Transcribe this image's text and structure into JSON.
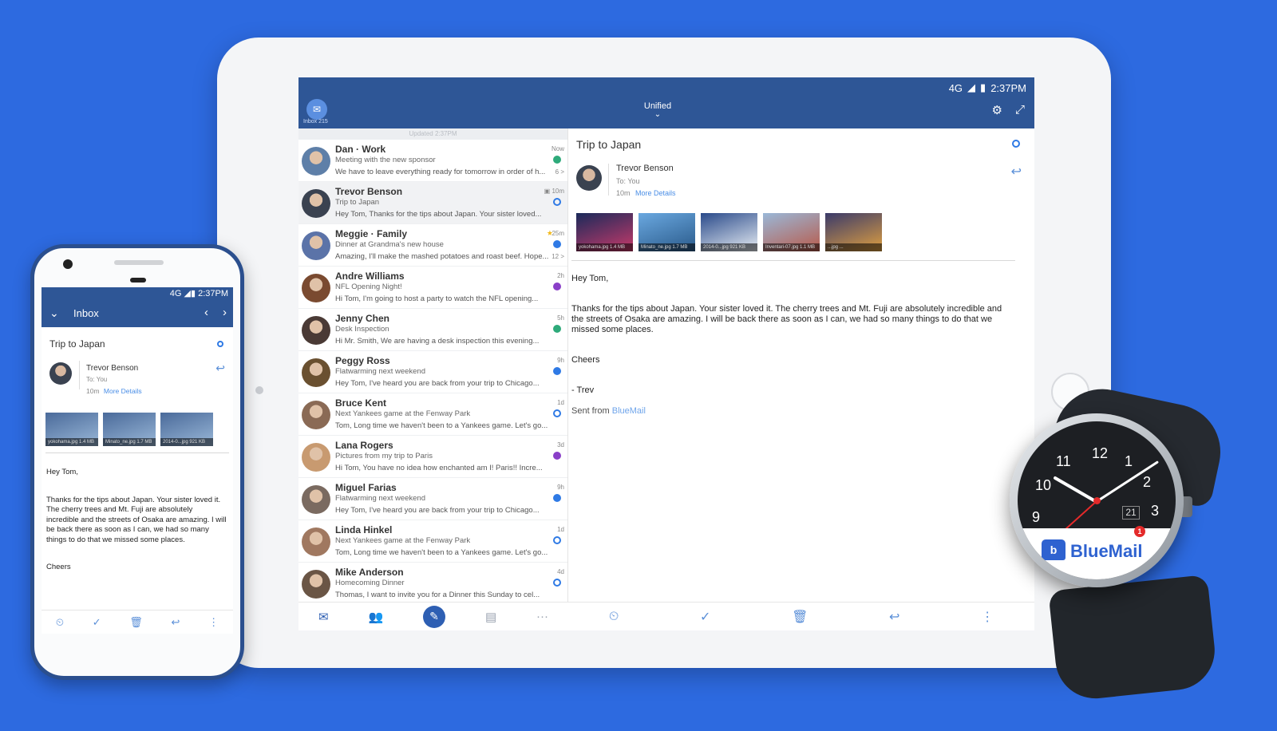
{
  "colors": {
    "background": "#2d6ae0",
    "app_bar": "#2e5696",
    "accent": "#2f7ae5",
    "link": "#4a8ee6",
    "brand": "#2e62d0",
    "badge": "#e42a2a"
  },
  "tablet": {
    "status": {
      "network": "4G",
      "signal_icon": "signal-icon",
      "battery_icon": "battery-icon",
      "time": "2:37PM"
    },
    "header": {
      "logo_icon": "bluemail-logo-icon",
      "inbox_label": "Inbox 215",
      "account": "Unified",
      "chevron": "⌄",
      "settings_icon": "gear-icon",
      "expand_icon": "expand-icon"
    },
    "list": {
      "updated": "Updated 2:37PM",
      "messages": [
        {
          "sender": "Dan · Work",
          "subject": "Meeting with the new sponsor",
          "preview": "We have to leave everything ready for tomorrow in order of h...",
          "time": "Now",
          "dot": "#2eaa7a",
          "dot_style": "filled",
          "count": "6 >",
          "avatar": "#5e7fa8"
        },
        {
          "sender": "Trevor Benson",
          "subject": "Trip to Japan",
          "preview": "Hey Tom, Thanks for the tips about Japan. Your sister loved...",
          "time": "▣ 10m",
          "dot": "#2f7ae5",
          "dot_style": "ring",
          "count": "",
          "avatar": "#3a4250"
        },
        {
          "sender": "Meggie · Family",
          "subject": "Dinner at Grandma's new house",
          "preview": "Amazing, I'll make the mashed potatoes and roast beef. Hope...",
          "time": "25m",
          "star": "★",
          "dot": "#2f7ae5",
          "dot_style": "filled",
          "count": "12 >",
          "avatar": "#5b73a8"
        },
        {
          "sender": "Andre Williams",
          "subject": "NFL Opening Night!",
          "preview": "Hi Tom, I'm going to host a party to watch the NFL opening...",
          "time": "2h",
          "dot": "#8a3fc8",
          "dot_style": "filled",
          "count": "",
          "avatar": "#7a4a30"
        },
        {
          "sender": "Jenny Chen",
          "subject": "Desk Inspection",
          "preview": "Hi Mr. Smith, We are having a desk inspection this evening...",
          "time": "5h",
          "dot": "#2eaa7a",
          "dot_style": "filled",
          "count": "",
          "avatar": "#4a3a35"
        },
        {
          "sender": "Peggy Ross",
          "subject": "Flatwarming next weekend",
          "preview": "Hey Tom, I've heard you are back from your trip to Chicago...",
          "time": "9h",
          "dot": "#2f7ae5",
          "dot_style": "filled",
          "count": "",
          "avatar": "#6a5030"
        },
        {
          "sender": "Bruce Kent",
          "subject": "Next Yankees game at the Fenway Park",
          "preview": "Tom, Long time we haven't been to a Yankees game. Let's go...",
          "time": "1d",
          "dot": "#2f7ae5",
          "dot_style": "ring",
          "count": "",
          "avatar": "#8a6a55"
        },
        {
          "sender": "Lana Rogers",
          "subject": "Pictures from my trip to Paris",
          "preview": "Hi Tom, You have no idea how enchanted am I! Paris!! Incre...",
          "time": "3d",
          "dot": "#8a3fc8",
          "dot_style": "filled",
          "count": "",
          "avatar": "#c89a70"
        },
        {
          "sender": "Miguel Farias",
          "subject": "Flatwarming next weekend",
          "preview": "Hey Tom, I've heard you are back from your trip to Chicago...",
          "time": "9h",
          "dot": "#2f7ae5",
          "dot_style": "filled",
          "count": "",
          "avatar": "#7a6a60"
        },
        {
          "sender": "Linda Hinkel",
          "subject": "Next Yankees game at the Fenway Park",
          "preview": "Tom, Long time we haven't been to a Yankees game. Let's go...",
          "time": "1d",
          "dot": "#2f7ae5",
          "dot_style": "ring",
          "count": "",
          "avatar": "#a07860"
        },
        {
          "sender": "Mike Anderson",
          "subject": "Homecoming Dinner",
          "preview": "Thomas, I want to invite you for a Dinner this Sunday to cel...",
          "time": "4d",
          "dot": "#2f7ae5",
          "dot_style": "ring",
          "count": "",
          "avatar": "#6a5545"
        }
      ],
      "bottom_bar": [
        "inbox-icon",
        "contacts-icon",
        "compose-icon",
        "clipboard-icon",
        "more-dots-icon"
      ]
    },
    "detail": {
      "subject": "Trip to Japan",
      "from": "Trevor Benson",
      "to": "To: You",
      "time": "10m",
      "more_details": "More Details",
      "reply_icon": "reply-all-icon",
      "attachments": [
        {
          "name": "yokohama.jpg",
          "size": "1.4 MB",
          "colors": [
            "#1a2a5a",
            "#c83a6a"
          ]
        },
        {
          "name": "Minato_ne.jpg",
          "size": "1.7 MB",
          "colors": [
            "#6aa8e0",
            "#2a5a8a"
          ]
        },
        {
          "name": "2014-0...jpg",
          "size": "921 KB",
          "colors": [
            "#2a4a8a",
            "#e8eef4"
          ]
        },
        {
          "name": "Inventari-07.jpg",
          "size": "1.1 MB",
          "colors": [
            "#9ab8d8",
            "#b85a4a"
          ]
        },
        {
          "name": "...jpg",
          "size": "...",
          "colors": [
            "#3a3a6a",
            "#e0a040"
          ]
        }
      ],
      "body": [
        "Hey Tom,",
        "Thanks for the tips about Japan. Your sister loved it. The cherry trees and Mt. Fuji are absolutely incredible and the streets of Osaka are amazing. I will be back there as soon as I can, we had so many things to do that we missed some places.",
        "Cheers",
        "- Trev"
      ],
      "signature_prefix": "Sent from",
      "signature_link": "BlueMail",
      "bottom_bar": [
        "snooze-icon",
        "check-icon",
        "trash-icon",
        "reply-all-icon",
        "more-vertical-icon"
      ]
    }
  },
  "phone": {
    "status": {
      "network": "4G",
      "time": "2:37PM"
    },
    "header": {
      "back_icon": "chevron-down-icon",
      "title": "Inbox",
      "prev_icon": "chevron-left-icon",
      "next_icon": "chevron-right-icon"
    },
    "subject": "Trip to Japan",
    "from": "Trevor Benson",
    "to": "To: You",
    "time": "10m",
    "more_details": "More Details",
    "body": [
      "Hey Tom,",
      "Thanks for the tips about Japan. Your sister loved it. The cherry trees and Mt. Fuji are absolutely incredible and the streets of Osaka are amazing. I will be back there as soon as I can, we had so many things to do that we missed some places.",
      "Cheers"
    ],
    "attachments": [
      {
        "name": "yokohama.jpg",
        "size": "1.4 MB"
      },
      {
        "name": "Minato_ne.jpg",
        "size": "1.7 MB"
      },
      {
        "name": "2014-0...jpg",
        "size": "921 KB"
      }
    ]
  },
  "watch": {
    "numbers": [
      "12",
      "1",
      "2",
      "3",
      "9",
      "10",
      "11"
    ],
    "date": "21",
    "badge_count": "1",
    "brand": "BlueMail",
    "logo_icon": "bluemail-logo-icon"
  }
}
